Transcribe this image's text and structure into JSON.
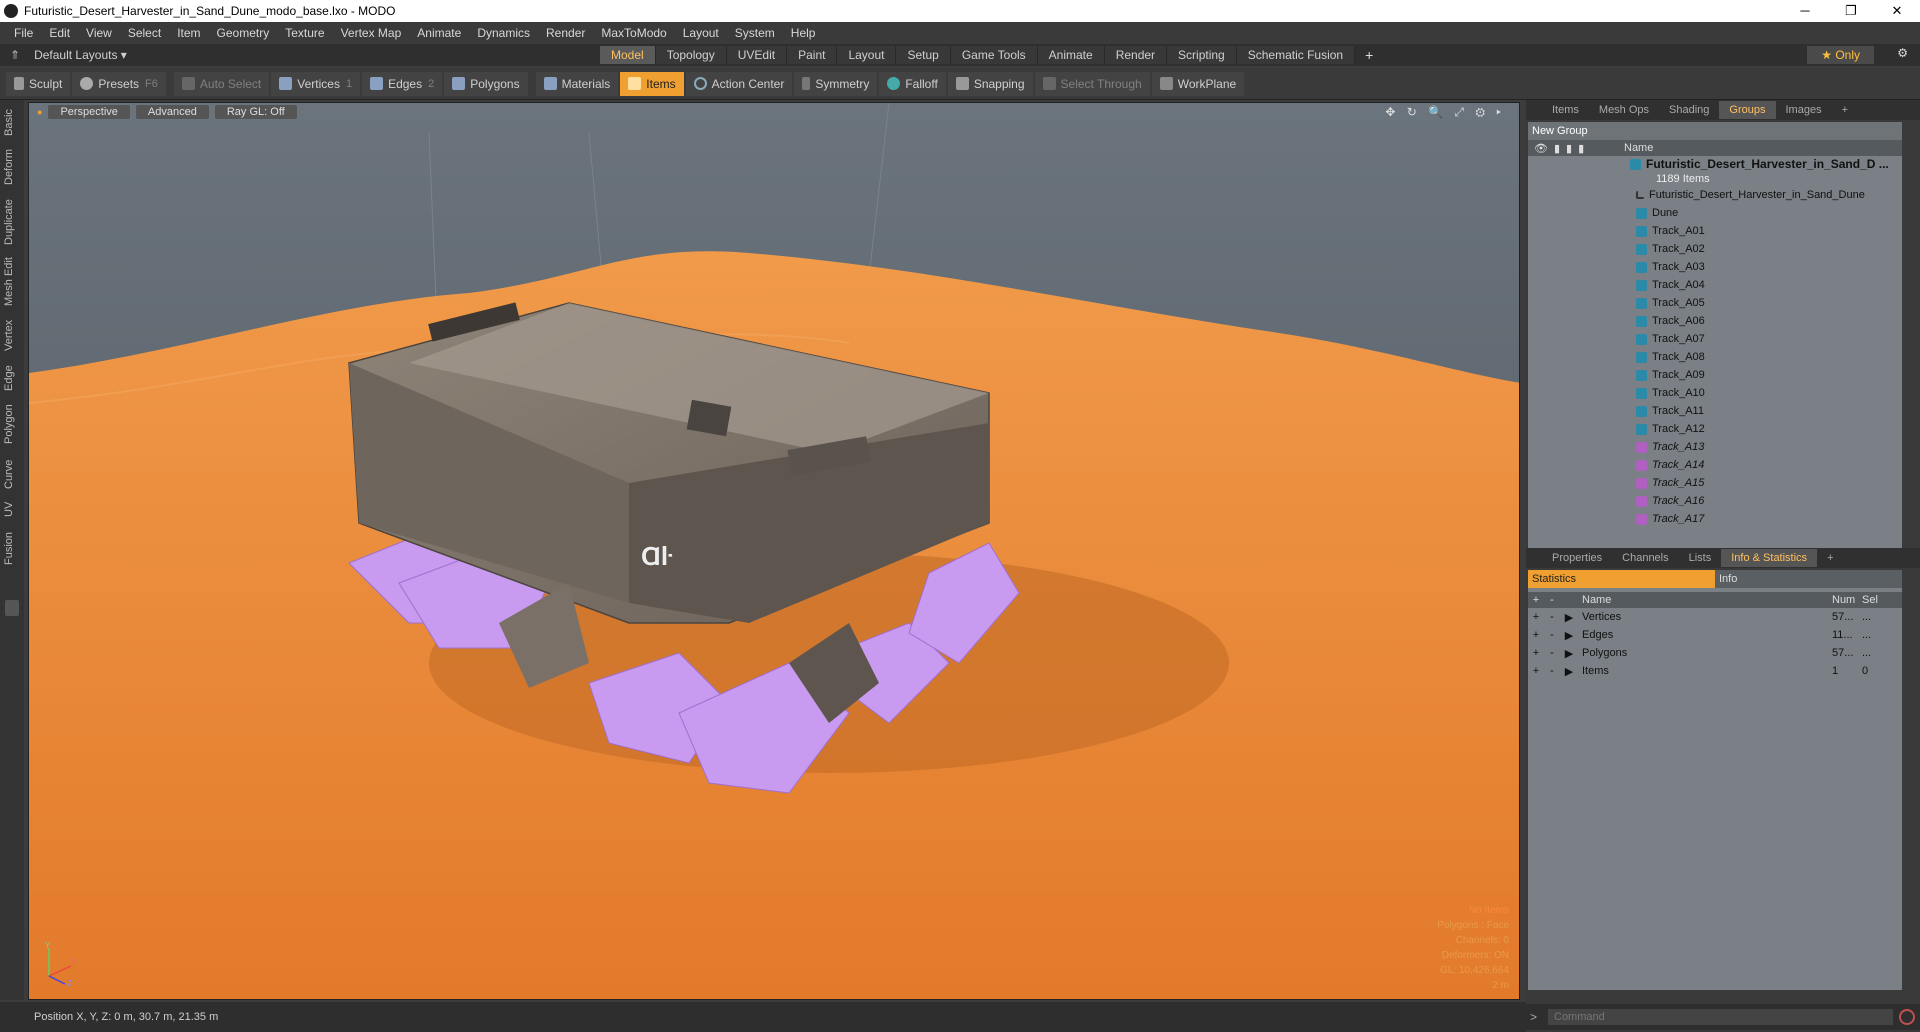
{
  "window": {
    "title": "Futuristic_Desert_Harvester_in_Sand_Dune_modo_base.lxo - MODO",
    "min": "─",
    "max": "❐",
    "close": "✕"
  },
  "menu": [
    "File",
    "Edit",
    "View",
    "Select",
    "Item",
    "Geometry",
    "Texture",
    "Vertex Map",
    "Animate",
    "Dynamics",
    "Render",
    "MaxToModo",
    "Layout",
    "System",
    "Help"
  ],
  "layout": {
    "name": "Default Layouts ▾",
    "tabs": [
      "Model",
      "Topology",
      "UVEdit",
      "Paint",
      "Layout",
      "Setup",
      "Game Tools",
      "Animate",
      "Render",
      "Scripting",
      "Schematic Fusion"
    ],
    "active_tab": "Model",
    "add": "+",
    "only_label": "★  Only"
  },
  "toolbar": {
    "sculpt": "Sculpt",
    "presets": "Presets",
    "presets_key": "F6",
    "auto_select": "Auto Select",
    "vertices": "Vertices",
    "vertices_key": "1",
    "edges": "Edges",
    "edges_key": "2",
    "polygons": "Polygons",
    "materials": "Materials",
    "items": "Items",
    "action_center": "Action Center",
    "symmetry": "Symmetry",
    "falloff": "Falloff",
    "snapping": "Snapping",
    "select_through": "Select Through",
    "workplane": "WorkPlane"
  },
  "left_tabs": [
    "Basic",
    "Deform",
    "Duplicate",
    "Mesh Edit",
    "Vertex",
    "Edge",
    "Polygon",
    "Curve",
    "UV",
    "Fusion"
  ],
  "viewport": {
    "perspective": "Perspective",
    "advanced": "Advanced",
    "raygl": "Ray GL: Off",
    "icons": "✥ ↻ 🔍 ⤢ ⚙ ▸",
    "info": [
      "No Items",
      "Polygons : Face",
      "Channels: 0",
      "Deformers: ON",
      "GL: 10,426,664",
      "2 m"
    ],
    "decal": "Ɑŀ"
  },
  "status": {
    "position": "Position X, Y, Z:   0 m, 30.7 m, 21.35 m"
  },
  "groups_panel": {
    "tabs": [
      "Items",
      "Mesh Ops",
      "Shading",
      "Groups",
      "Images"
    ],
    "active_tab": "Groups",
    "add": "+",
    "new_group": "New Group",
    "header_name": "Name",
    "root": {
      "name": "Futuristic_Desert_Harvester_in_Sand_D ...",
      "count": "1189 Items"
    },
    "items": [
      {
        "name": "Futuristic_Desert_Harvester_in_Sand_Dune",
        "type": "locator"
      },
      {
        "name": "Dune",
        "type": "mesh"
      },
      {
        "name": "Track_A01",
        "type": "mesh"
      },
      {
        "name": "Track_A02",
        "type": "mesh"
      },
      {
        "name": "Track_A03",
        "type": "mesh"
      },
      {
        "name": "Track_A04",
        "type": "mesh"
      },
      {
        "name": "Track_A05",
        "type": "mesh"
      },
      {
        "name": "Track_A06",
        "type": "mesh"
      },
      {
        "name": "Track_A07",
        "type": "mesh"
      },
      {
        "name": "Track_A08",
        "type": "mesh"
      },
      {
        "name": "Track_A09",
        "type": "mesh"
      },
      {
        "name": "Track_A10",
        "type": "mesh"
      },
      {
        "name": "Track_A11",
        "type": "mesh"
      },
      {
        "name": "Track_A12",
        "type": "mesh"
      },
      {
        "name": "Track_A13",
        "type": "instance"
      },
      {
        "name": "Track_A14",
        "type": "instance"
      },
      {
        "name": "Track_A15",
        "type": "instance"
      },
      {
        "name": "Track_A16",
        "type": "instance"
      },
      {
        "name": "Track_A17",
        "type": "instance"
      }
    ]
  },
  "info_panel": {
    "tabs": [
      "Properties",
      "Channels",
      "Lists",
      "Info & Statistics"
    ],
    "active_tab": "Info & Statistics",
    "add": "+",
    "sub_tabs": [
      "Statistics",
      "Info"
    ],
    "headers": {
      "name": "Name",
      "num": "Num",
      "sel": "Sel"
    },
    "rows": [
      {
        "name": "Vertices",
        "num": "57...",
        "sel": "..."
      },
      {
        "name": "Edges",
        "num": "11...",
        "sel": "..."
      },
      {
        "name": "Polygons",
        "num": "57...",
        "sel": "..."
      },
      {
        "name": "Items",
        "num": "1",
        "sel": "0"
      }
    ],
    "command_placeholder": "Command"
  },
  "colors": {
    "accent": "#f0a030",
    "sand": "#e8893d",
    "track": "#c89af0",
    "sky": "#5c6670"
  }
}
